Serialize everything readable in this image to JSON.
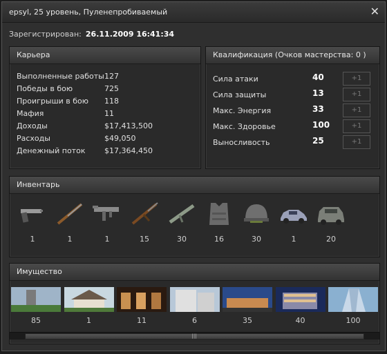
{
  "window": {
    "title": "epsyl, 25 уровень, Пуленепробиваемый",
    "close_glyph": "✕"
  },
  "registration": {
    "label": "Зарегистрирован:",
    "value": "26.11.2009 16:41:34"
  },
  "career": {
    "heading": "Карьера",
    "stats": [
      {
        "label": "Выполненные работы",
        "value": "127"
      },
      {
        "label": "Победы в бою",
        "value": "725"
      },
      {
        "label": "Проигрыши в бою",
        "value": "118"
      },
      {
        "label": "Мафия",
        "value": "11"
      },
      {
        "label": "Доходы",
        "value": "$17,413,500"
      },
      {
        "label": "Расходы",
        "value": "$49,050"
      },
      {
        "label": "Денежный поток",
        "value": "$17,364,450"
      }
    ]
  },
  "qualification": {
    "heading": "Квалификация (Очков мастерства: 0 )",
    "items": [
      {
        "label": "Сила атаки",
        "value": "40",
        "button": "+1"
      },
      {
        "label": "Сила защиты",
        "value": "13",
        "button": "+1"
      },
      {
        "label": "Макс. Энергия",
        "value": "33",
        "button": "+1"
      },
      {
        "label": "Макс. Здоровье",
        "value": "100",
        "button": "+1"
      },
      {
        "label": "Выносливость",
        "value": "25",
        "button": "+1"
      }
    ]
  },
  "inventory": {
    "heading": "Инвентарь",
    "items": [
      {
        "icon": "pistol-icon",
        "count": "1"
      },
      {
        "icon": "shotgun-icon",
        "count": "1"
      },
      {
        "icon": "submachine-gun-icon",
        "count": "1"
      },
      {
        "icon": "assault-rifle-icon",
        "count": "15"
      },
      {
        "icon": "carbine-icon",
        "count": "30"
      },
      {
        "icon": "body-armor-icon",
        "count": "16"
      },
      {
        "icon": "helmet-icon",
        "count": "30"
      },
      {
        "icon": "sedan-car-icon",
        "count": "1"
      },
      {
        "icon": "suv-car-icon",
        "count": "20"
      }
    ]
  },
  "property": {
    "heading": "Имущество",
    "items": [
      {
        "icon": "apartment-tower-icon",
        "count": "85"
      },
      {
        "icon": "house-icon",
        "count": "1"
      },
      {
        "icon": "restaurant-icon",
        "count": "11"
      },
      {
        "icon": "residential-building-icon",
        "count": "6"
      },
      {
        "icon": "modern-building-icon",
        "count": "35"
      },
      {
        "icon": "office-complex-icon",
        "count": "40"
      },
      {
        "icon": "skyscraper-icon",
        "count": "100"
      }
    ]
  },
  "colors": {
    "background": "#2f2f2f",
    "panel": "#2a2a2a",
    "header": "#4a4a4a",
    "text": "#e0e0e0"
  }
}
